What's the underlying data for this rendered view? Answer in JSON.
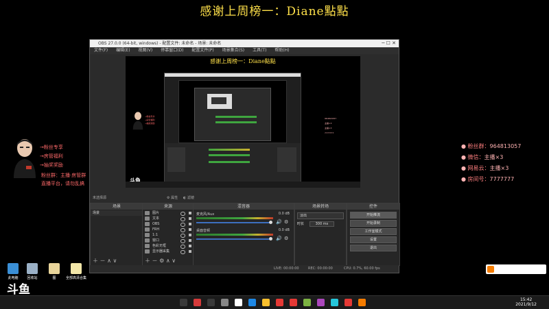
{
  "overlay": {
    "banner": "感谢上周榜一：Diane點點",
    "left_info": [
      "→粉丝专享",
      "→房管福利",
      "→抽奖奖励",
      "粉丝群：主播·房管群",
      "直播平台，请勿乱搞"
    ],
    "right_info": [
      {
        "label": "粉丝群：",
        "value": "964813057"
      },
      {
        "label": "微信：",
        "value": "主播×3"
      },
      {
        "label": "网易云：",
        "value": "主播×3"
      },
      {
        "label": "房间号：",
        "value": "7777777"
      }
    ],
    "logo": "斗鱼"
  },
  "obs": {
    "title": "OBS 27.0.0 (64-bit, windows) - 配置文件: 未命名 - 场景: 未命名",
    "menu": [
      "文件(F)",
      "编辑(E)",
      "视图(V)",
      "停靠窗口(D)",
      "配置文件(P)",
      "场景集合(S)",
      "工具(T)",
      "帮助(H)"
    ],
    "source_bar": {
      "label": "未选择源",
      "properties": "属性",
      "filters": "滤镜"
    },
    "scenes": {
      "header": "场景",
      "items": [
        "场景"
      ]
    },
    "sources": {
      "header": "来源",
      "items": [
        "图片",
        "文本",
        "OBS",
        "FRH",
        "1:1",
        "窗口",
        "色彩无框",
        "显示器采集"
      ]
    },
    "mixer": {
      "header": "混音器",
      "channels": [
        {
          "name": "麦克风/Aux",
          "db": "0.0 dB"
        },
        {
          "name": "桌面音频",
          "db": "0.0 dB"
        }
      ]
    },
    "transitions": {
      "header": "场景转场",
      "type": "淡出",
      "duration_label": "时长",
      "duration": "300 ms"
    },
    "controls": {
      "header": "控件",
      "buttons": [
        "开始推流",
        "开始录制",
        "工作室模式",
        "设置",
        "退出"
      ]
    },
    "status": {
      "live": "LIVE: 00:00:00",
      "rec": "REC: 00:00:00",
      "cpu": "CPU: 0.7%, 60.00 fps"
    }
  },
  "desktop": {
    "icons": [
      {
        "label": "此电脑",
        "color": "#3a8fd6"
      },
      {
        "label": "回收站",
        "color": "#9ab0c6"
      },
      {
        "label": "图",
        "color": "#e8d49a"
      },
      {
        "label": "全部高清合集",
        "color": "#f2e6a8"
      }
    ]
  },
  "taskbar": {
    "time": "15:42",
    "date": "2021/9/12",
    "apps": [
      "#3a3a3a",
      "#d53a3a",
      "#3a3a3a",
      "#888888",
      "#ffffff",
      "#1e88e5",
      "#fbc02d",
      "#e53935",
      "#e53935",
      "#7cb342",
      "#ab47bc",
      "#26c6da",
      "#e53935",
      "#f57c00"
    ]
  }
}
